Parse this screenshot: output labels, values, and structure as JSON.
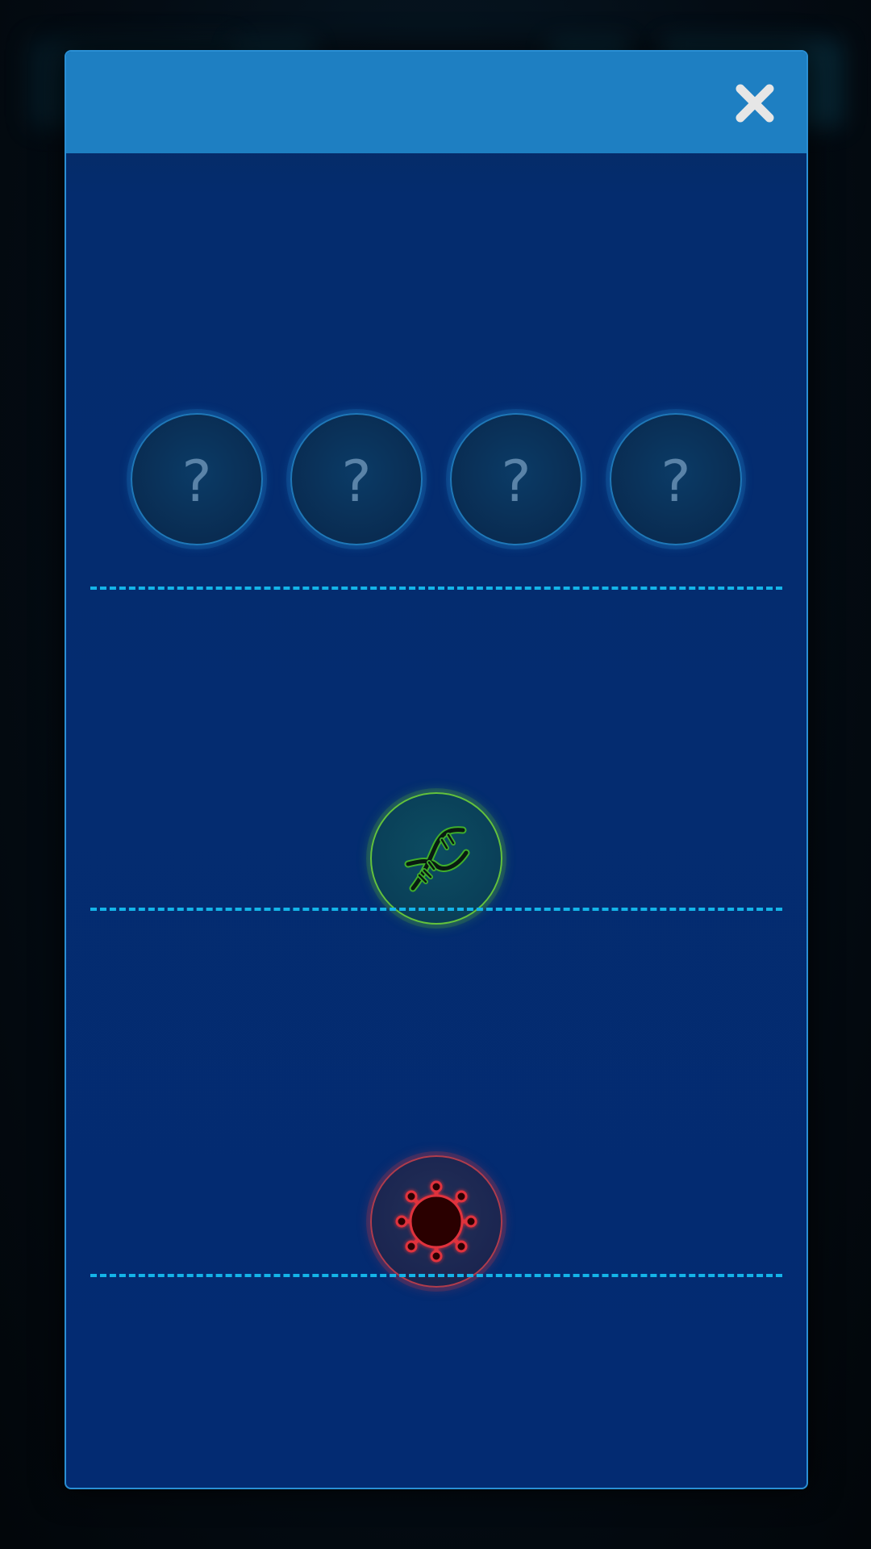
{
  "modal": {
    "close_icon": "close-icon",
    "locked_slots": [
      {
        "label": "?"
      },
      {
        "label": "?"
      },
      {
        "label": "?"
      },
      {
        "label": "?"
      }
    ],
    "ability_slot": {
      "icon": "dna-icon",
      "color": "#63c23c"
    },
    "pathogen_slot": {
      "icon": "virus-icon",
      "color": "#e0323c"
    },
    "divider_color": "#14b4e8",
    "header_color": "#1e7fc2"
  }
}
